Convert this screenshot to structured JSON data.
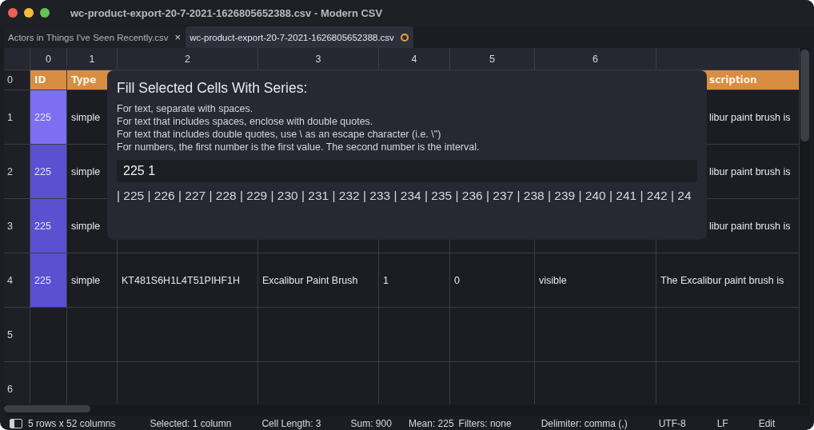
{
  "window": {
    "title": "wc-product-export-20-7-2021-1626805652388.csv - Modern CSV"
  },
  "tabs": [
    {
      "label": "Actors in Things I've Seen Recently.csv",
      "selected": false,
      "close": "×"
    },
    {
      "label": "wc-product-export-20-7-2021-1626805652388.csv",
      "selected": true,
      "modified": true
    }
  ],
  "table": {
    "columns": [
      "0",
      "1",
      "2",
      "3",
      "4",
      "5",
      "6"
    ],
    "rows": [
      {
        "label": "0",
        "kind": "header",
        "cells": [
          {
            "text": "ID",
            "selected": false
          },
          {
            "text": "Type",
            "selected": false
          },
          null,
          null,
          null,
          null,
          null,
          {
            "text": "scription",
            "selected": false,
            "partial": true
          }
        ]
      },
      {
        "label": "1",
        "kind": "data",
        "cells": [
          {
            "text": "225",
            "selected": true,
            "active": true
          },
          {
            "text": "simple",
            "selected": false
          },
          null,
          null,
          null,
          null,
          null,
          {
            "text": "libur paint brush is",
            "selected": false,
            "partial": true
          }
        ]
      },
      {
        "label": "2",
        "kind": "data",
        "cells": [
          {
            "text": "225",
            "selected": true,
            "active": false
          },
          {
            "text": "simple",
            "selected": false
          },
          null,
          null,
          null,
          null,
          null,
          {
            "text": "libur paint brush is",
            "selected": false,
            "partial": true
          }
        ]
      },
      {
        "label": "3",
        "kind": "data",
        "cells": [
          {
            "text": "225",
            "selected": true,
            "active": false
          },
          {
            "text": "simple",
            "selected": false
          },
          null,
          null,
          null,
          null,
          null,
          {
            "text": "libur paint brush is",
            "selected": false,
            "partial": true
          }
        ]
      },
      {
        "label": "4",
        "kind": "data",
        "cells": [
          {
            "text": "225",
            "selected": true,
            "active": false
          },
          {
            "text": "simple",
            "selected": false
          },
          {
            "text": "KT481S6H1L4T51PIHF1H",
            "selected": false
          },
          {
            "text": "Excalibur Paint Brush",
            "selected": false
          },
          {
            "text": "1",
            "selected": false
          },
          {
            "text": "0",
            "selected": false
          },
          {
            "text": "visible",
            "selected": false
          },
          {
            "text": "The Excalibur paint brush is",
            "selected": false,
            "partial": false
          }
        ]
      },
      {
        "label": "5",
        "kind": "data",
        "cells": []
      },
      {
        "label": "6",
        "kind": "data",
        "cells": []
      }
    ]
  },
  "dialog": {
    "title": "Fill Selected Cells With Series:",
    "help": [
      "For text, separate with spaces.",
      "For text that includes spaces, enclose with double quotes.",
      "For text that includes double quotes, use \\ as an escape character (i.e. \\\")",
      "For numbers, the first number is the first value. The second number is the interval."
    ],
    "value": "225 1",
    "preview": "| 225 | 226 | 227 | 228 | 229 | 230 | 231 | 232 | 233 | 234 | 235 | 236 | 237 | 238 | 239 | 240 | 241 | 242 | 24"
  },
  "status_bar": [
    "5 rows x 52 columns",
    "Selected: 1 column",
    "Cell Length: 3",
    "Sum: 900",
    "Mean: 225",
    "Filters: none",
    "Delimiter: comma (,)",
    "UTF-8",
    "LF",
    "Edit"
  ]
}
